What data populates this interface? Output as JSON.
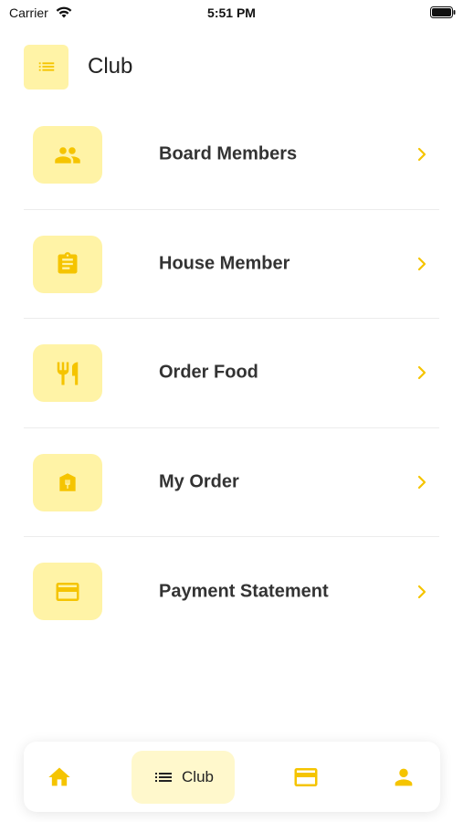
{
  "status_bar": {
    "carrier": "Carrier",
    "time": "5:51 PM"
  },
  "header": {
    "title": "Club",
    "menu_icon": "list-icon"
  },
  "menu": {
    "items": [
      {
        "label": "Board Members",
        "icon": "group-icon"
      },
      {
        "label": "House Member",
        "icon": "clipboard-icon"
      },
      {
        "label": "Order Food",
        "icon": "restaurant-icon"
      },
      {
        "label": "My Order",
        "icon": "shopping-bag-icon"
      },
      {
        "label": "Payment Statement",
        "icon": "credit-card-icon"
      }
    ]
  },
  "bottom_nav": {
    "items": [
      {
        "icon": "home-icon",
        "label": ""
      },
      {
        "icon": "list-icon",
        "label": "Club",
        "active": true
      },
      {
        "icon": "credit-card-icon",
        "label": ""
      },
      {
        "icon": "person-icon",
        "label": ""
      }
    ]
  },
  "colors": {
    "accent": "#f5c400",
    "tile_bg": "#fff3a6",
    "active_tab_bg": "#fff8cc",
    "divider": "#ececec"
  }
}
